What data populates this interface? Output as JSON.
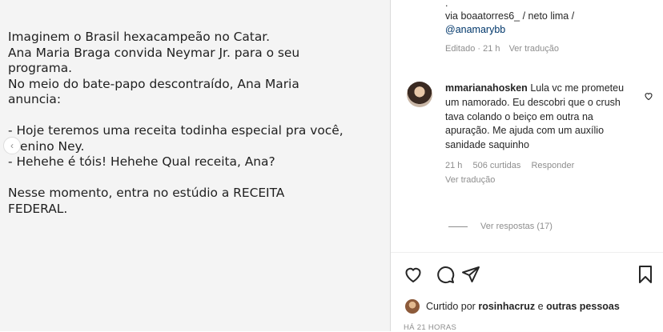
{
  "post": {
    "lines": [
      "Imaginem o Brasil hexacampeão no Catar.",
      "Ana Maria Braga convida Neymar Jr. para o seu",
      "programa.",
      "No meio do bate-papo descontraído, Ana Maria",
      "anuncia:",
      "",
      "- Hoje teremos uma receita todinha especial pra você,",
      "menino Ney.",
      "- Hehehe é tóis! Hehehe Qual receita, Ana?",
      "",
      "Nesse momento, entra no estúdio a RECEITA",
      "FEDERAL."
    ]
  },
  "caption": {
    "dot": ".",
    "credit_prefix": "via boaatorres6_ / neto lima /",
    "credit_tag": "@anamarybb",
    "edited": "Editado · 21 h",
    "see_translation": "Ver tradução"
  },
  "comment": {
    "username": "mmarianahosken",
    "text": "Lula vc me prometeu um namorado. Eu descobri que o crush tava colando o beiço em outra na apuração. Me ajuda com um auxílio sanidade saquinho",
    "time": "21 h",
    "likes": "506 curtidas",
    "reply": "Responder",
    "see_translation": "Ver tradução",
    "view_replies": "Ver respostas (17)"
  },
  "footer": {
    "liked_prefix": "Curtido por ",
    "liked_user": "rosinhacruz",
    "liked_middle": " e ",
    "liked_others": "outras pessoas",
    "timestamp": "HÁ 21 HORAS"
  }
}
